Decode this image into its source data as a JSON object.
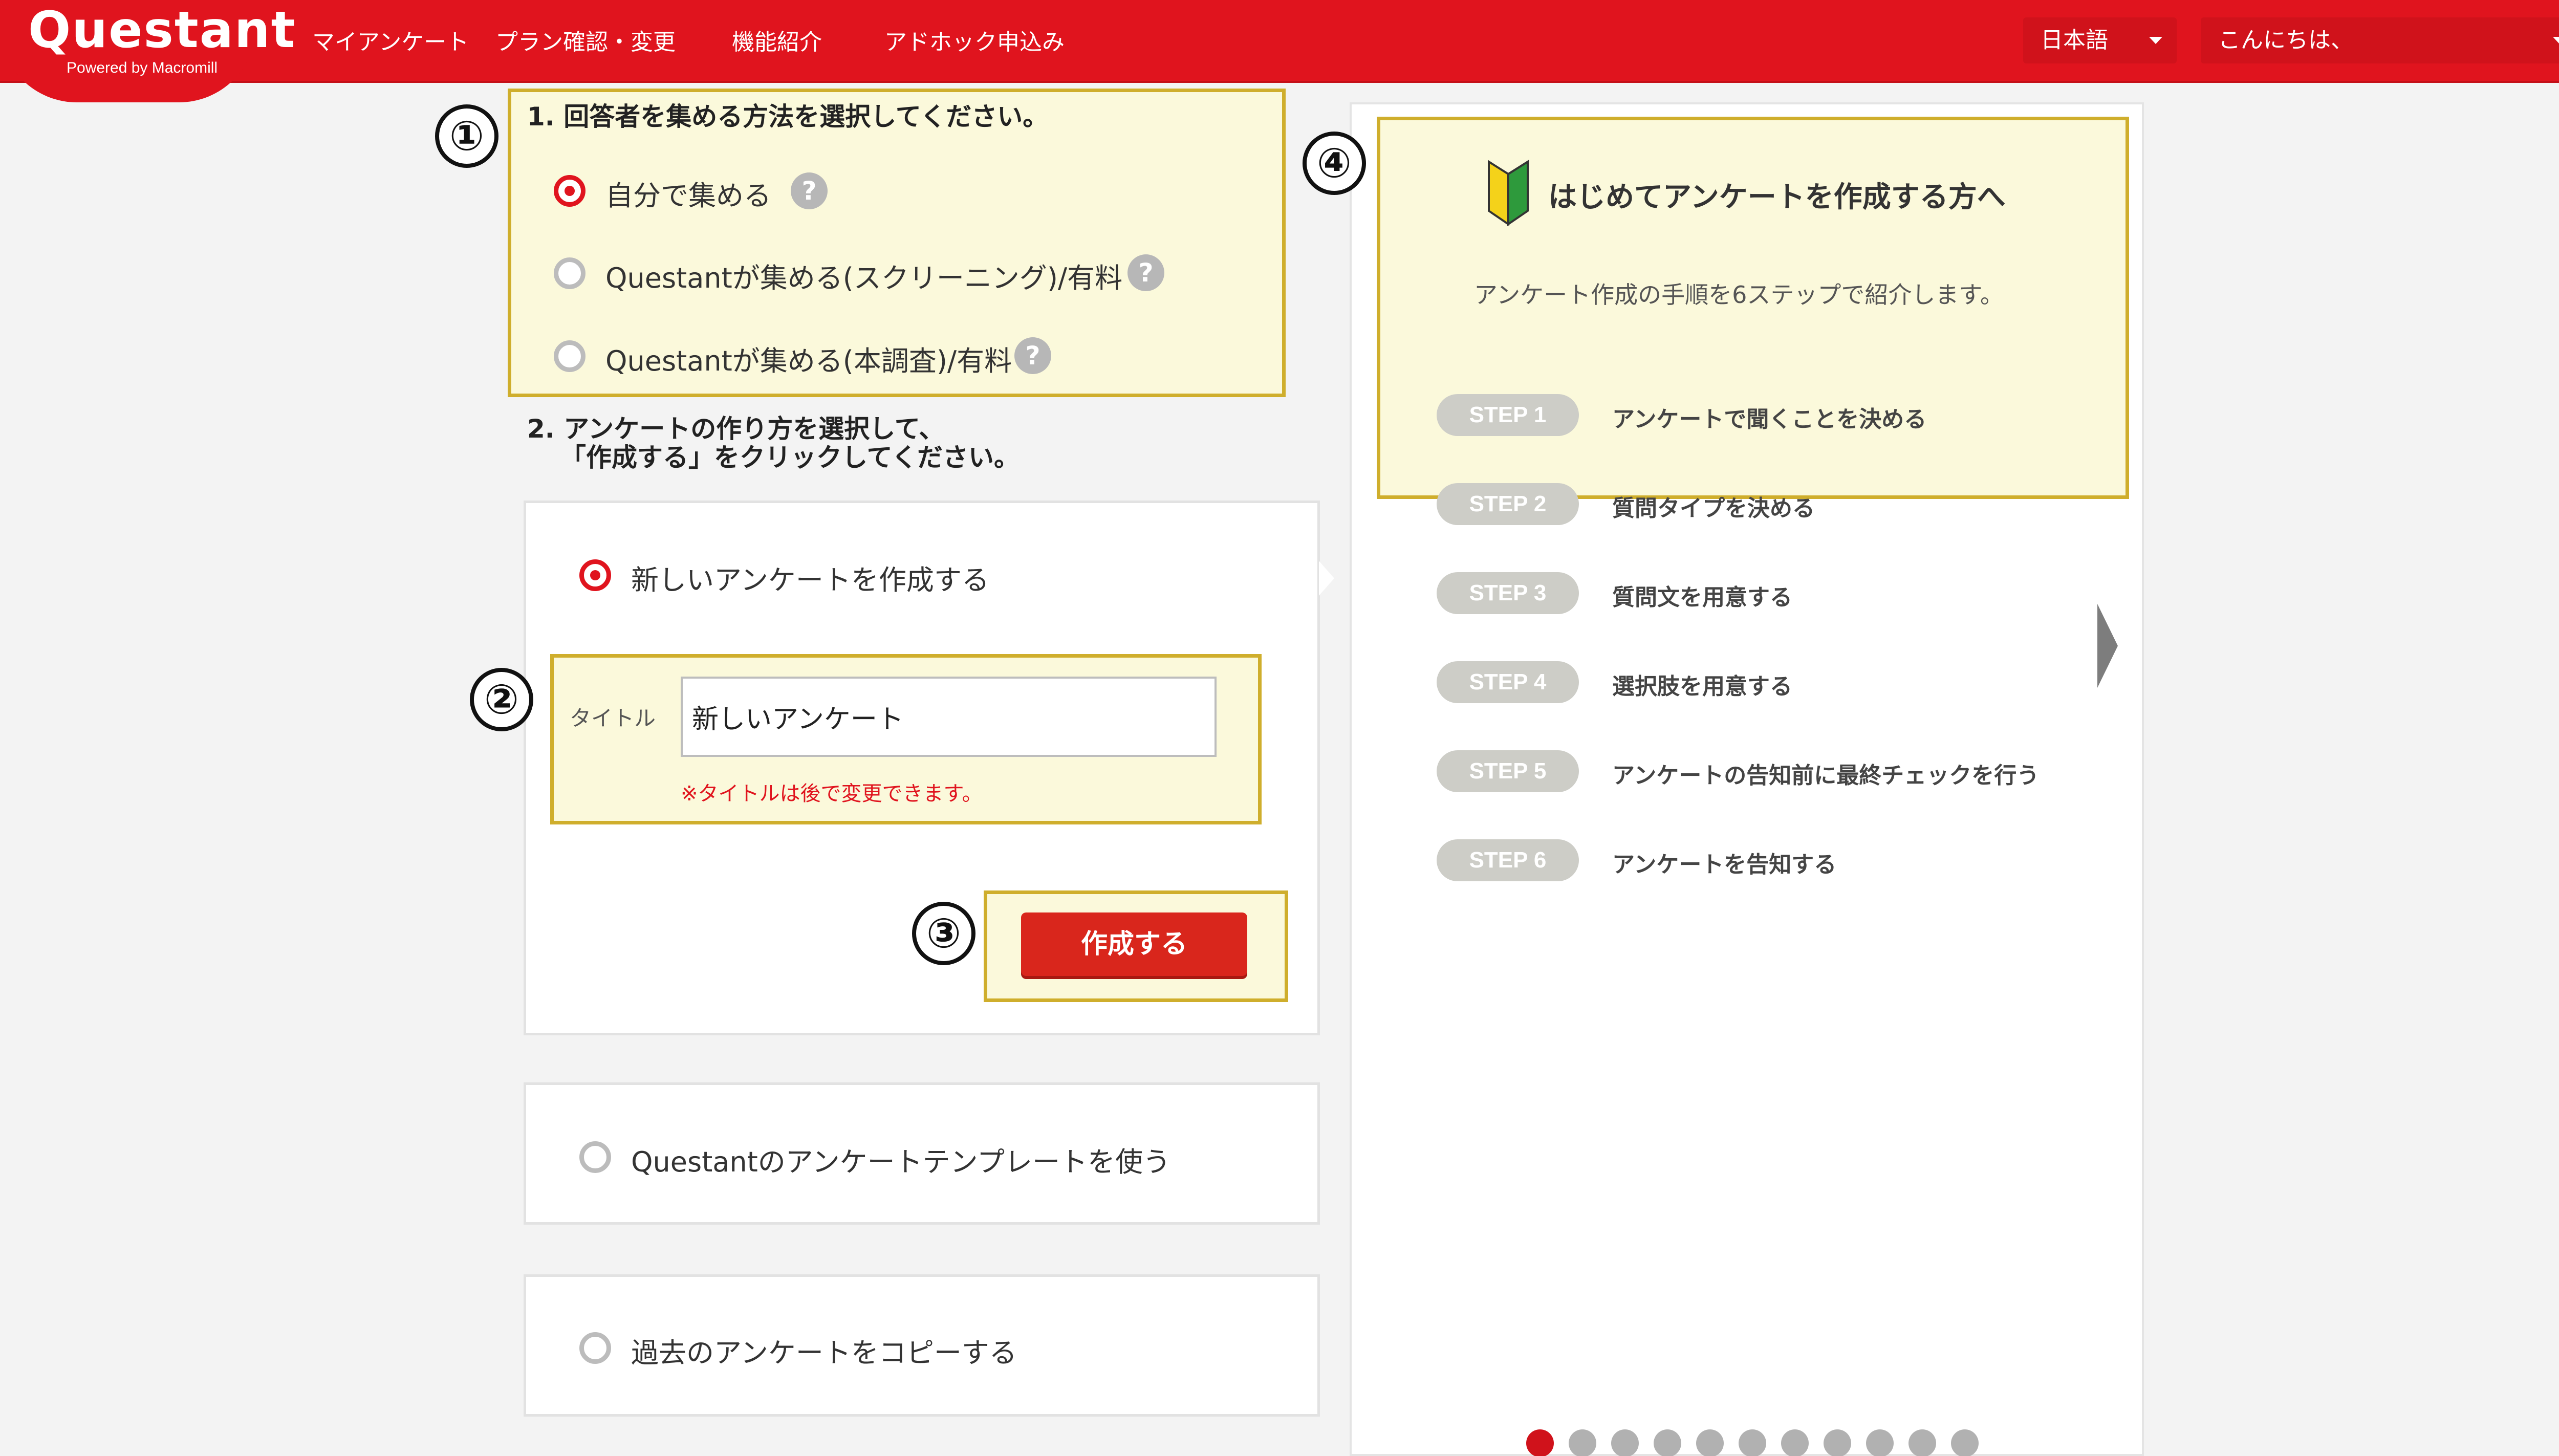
{
  "header": {
    "logo": "Questant",
    "logo_sub": "Powered by Macromill",
    "nav": [
      "マイアンケート",
      "プラン確認・変更",
      "機能紹介",
      "アドホック申込み"
    ],
    "language": "日本語",
    "greeting": "こんにちは、",
    "help": "?"
  },
  "section1": {
    "heading": "1. 回答者を集める方法を選択してください。",
    "options": [
      {
        "label": "自分で集める",
        "selected": true
      },
      {
        "label": "Questantが集める(スクリーニング)/有料",
        "selected": false
      },
      {
        "label": "Questantが集める(本調査)/有料",
        "selected": false
      }
    ],
    "help_badge": "?"
  },
  "section2": {
    "heading_line1": "2. アンケートの作り方を選択して、",
    "heading_line2": "「作成する」をクリックしてください。",
    "new_survey": {
      "label": "新しいアンケートを作成する",
      "title_label": "タイトル",
      "title_value": "新しいアンケート",
      "note": "※タイトルは後で変更できます。",
      "create_button": "作成する"
    },
    "template_option": "Questantのアンケートテンプレートを使う",
    "copy_option": "過去のアンケートをコピーする"
  },
  "markers": [
    "①",
    "②",
    "③",
    "④"
  ],
  "guide": {
    "title": "はじめてアンケートを作成する方へ",
    "subtitle": "アンケート作成の手順を6ステップで紹介します。",
    "steps": [
      {
        "badge": "STEP 1",
        "text": "アンケートで聞くことを決める"
      },
      {
        "badge": "STEP 2",
        "text": "質問タイプを決める"
      },
      {
        "badge": "STEP 3",
        "text": "質問文を用意する"
      },
      {
        "badge": "STEP 4",
        "text": "選択肢を用意する"
      },
      {
        "badge": "STEP 5",
        "text": "アンケートの告知前に最終チェックを行う"
      },
      {
        "badge": "STEP 6",
        "text": "アンケートを告知する"
      }
    ],
    "carousel": {
      "total_pages": 11,
      "current_page": 1
    }
  },
  "colors": {
    "brand_red": "#e0141e",
    "highlight_border": "#cfae2c",
    "highlight_fill": "#fbf9db",
    "step_pill": "#cdcdc7"
  }
}
